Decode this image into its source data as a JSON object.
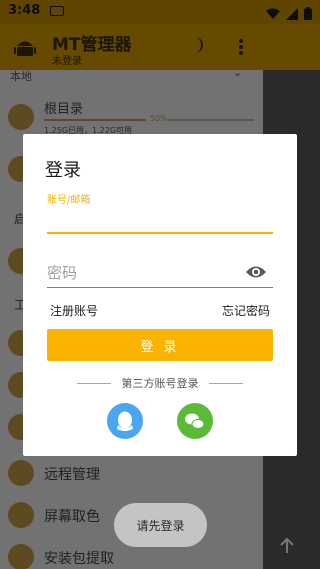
{
  "status_bar": {
    "time": "3:48"
  },
  "app_bar": {
    "title": "MT管理器",
    "subtitle": "未登录"
  },
  "drawer": {
    "section_top": "本地",
    "storage": {
      "name": "根目录",
      "percent": "50%",
      "info": "1.25G已用，1.22G可用"
    },
    "side_labels": [
      "启",
      "工"
    ],
    "items": [
      {
        "label": "远程管理",
        "icon": "remote-icon"
      },
      {
        "label": "屏幕取色",
        "icon": "color-picker-icon"
      },
      {
        "label": "安装包提取",
        "icon": "package-extract-icon"
      }
    ]
  },
  "dialog": {
    "title": "登录",
    "account_label": "账号/邮箱",
    "account_value": "",
    "password_placeholder": "密码",
    "register_label": "注册账号",
    "forgot_label": "忘记密码",
    "login_button": "登 录",
    "third_party_label": "第三方账号登录",
    "providers": [
      "qq-icon",
      "wechat-icon"
    ]
  },
  "toast": {
    "text": "请先登录"
  },
  "colors": {
    "accent": "#fbb301",
    "qq": "#4aa6f1",
    "wechat": "#5bbb37"
  }
}
